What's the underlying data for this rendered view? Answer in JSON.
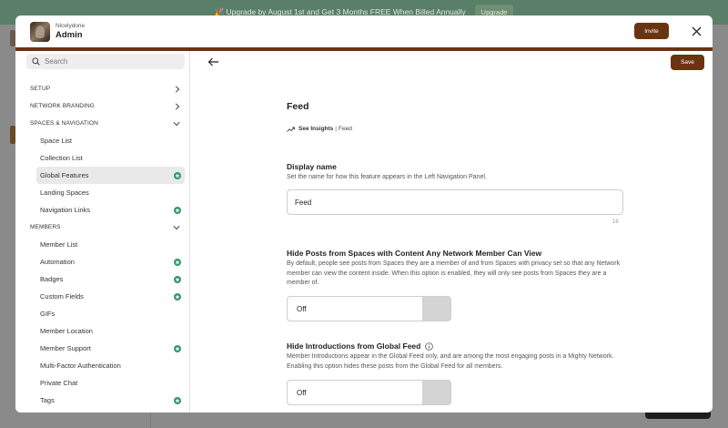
{
  "background": {
    "banner_text": "🎉 Upgrade by August 1st and Get 3 Months FREE When Billed Annually",
    "banner_button": "Upgrade"
  },
  "header": {
    "network_name": "Nicelydone",
    "role": "Admin",
    "invite_label": "Invite",
    "close_icon": "close-icon"
  },
  "sidebar": {
    "search_placeholder": "Search",
    "sections": [
      {
        "label": "SETUP",
        "expanded": false,
        "items": []
      },
      {
        "label": "NETWORK BRANDING",
        "expanded": false,
        "items": []
      },
      {
        "label": "SPACES & NAVIGATION",
        "expanded": true,
        "items": [
          {
            "label": "Space List",
            "badge": false,
            "active": false
          },
          {
            "label": "Collection List",
            "badge": false,
            "active": false
          },
          {
            "label": "Global Features",
            "badge": true,
            "active": true
          },
          {
            "label": "Landing Spaces",
            "badge": false,
            "active": false
          },
          {
            "label": "Navigation Links",
            "badge": true,
            "active": false
          }
        ]
      },
      {
        "label": "MEMBERS",
        "expanded": true,
        "items": [
          {
            "label": "Member List",
            "badge": false,
            "active": false
          },
          {
            "label": "Automation",
            "badge": true,
            "active": false
          },
          {
            "label": "Badges",
            "badge": true,
            "active": false
          },
          {
            "label": "Custom Fields",
            "badge": true,
            "active": false
          },
          {
            "label": "GIFs",
            "badge": false,
            "active": false
          },
          {
            "label": "Member Location",
            "badge": false,
            "active": false
          },
          {
            "label": "Member Support",
            "badge": true,
            "active": false
          },
          {
            "label": "Multi-Factor Authentication",
            "badge": false,
            "active": false
          },
          {
            "label": "Private Chat",
            "badge": false,
            "active": false
          },
          {
            "label": "Tags",
            "badge": true,
            "active": false
          }
        ]
      }
    ]
  },
  "main": {
    "save_label": "Save",
    "title": "Feed",
    "insights_label": "See Insights",
    "insights_separator": "|",
    "insights_crumb": "Feed",
    "display_name": {
      "label": "Display name",
      "help": "Set the name for how this feature appears in the Left Navigation Panel.",
      "value": "Feed",
      "char_count": "16"
    },
    "hide_posts": {
      "label": "Hide Posts from Spaces with Content Any Network Member Can View",
      "help": "By default, people see posts from Spaces they are a member of and from Spaces with privacy set so that any Network member can view the content inside. When this option is enabled, they will only see posts from Spaces they are a member of.",
      "value": "Off"
    },
    "hide_intros": {
      "label": "Hide Introductions from Global Feed",
      "help": "Member Introductions appear in the Global Feed only, and are among the most engaging posts in a Mighty Network. Enabling this option hides these posts from the Global Feed for all members.",
      "value": "Off"
    }
  },
  "colors": {
    "accent": "#6b3410",
    "badge": "#2f9a6a",
    "active_bg": "#e9e9e9"
  }
}
